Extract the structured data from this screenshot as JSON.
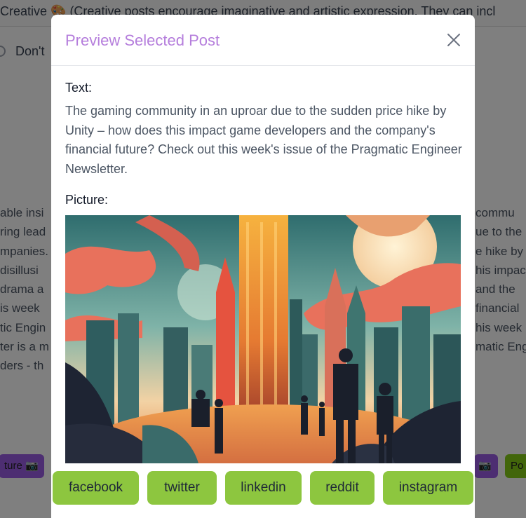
{
  "background": {
    "top_text": "Creative 🎨 (Creative posts encourage imaginative and artistic expression. They can incl",
    "dont_label": "Don't",
    "left_lines": [
      "able insi",
      "ring lead",
      "mpanies.",
      "disillusi",
      " drama a",
      "is week",
      "tic Engin",
      "ter is a m",
      "ders - th"
    ],
    "right_lines": [
      " commu",
      "ue to the",
      "e hike by",
      "his impac",
      "and the",
      "financial",
      "his week",
      "matic Eng",
      ""
    ],
    "left_button": "ture 📷",
    "right_button_1": "📷",
    "right_button_2": "Po"
  },
  "modal": {
    "title": "Preview Selected Post",
    "text_label": "Text:",
    "text_body": "The gaming community in an uproar due to the sudden price hike by Unity – how does this impact game developers and the company's financial future? Check out this week's issue of the Pragmatic Engineer Newsletter.",
    "picture_label": "Picture:",
    "picture_description": "illustrated city skyline with silhouetted people",
    "close_icon": "close-icon"
  },
  "platforms": [
    "facebook",
    "twitter",
    "linkedin",
    "reddit",
    "instagram"
  ],
  "colors": {
    "title": "#b57edc",
    "platform_button": "#8dc63f",
    "overlay": "rgba(0,0,0,0.5)"
  }
}
